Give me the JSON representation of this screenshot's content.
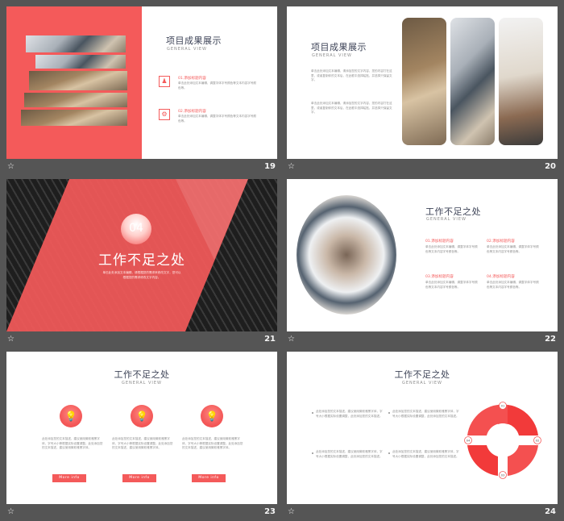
{
  "slides": [
    {
      "number": "19",
      "title": "项目成果展示",
      "subtitle": "GENERAL VIEW",
      "items": [
        {
          "heading": "01.添加标题内容",
          "text": "单击此处添加文本编辑，调整字体字号颜色等文本内容字号颜色等。"
        },
        {
          "heading": "02.添加标题内容",
          "text": "单击此处添加文本编辑，调整字体字号颜色等文本内容字号颜色等。"
        }
      ]
    },
    {
      "number": "20",
      "title": "项目成果展示",
      "subtitle": "GENERAL VIEW",
      "paragraphs": [
        "单击此处添加文本编辑，请添加您的文字内容，您的内容打在这里，或者复制你的文本后，在此框中选择粘贴，并选择只保留文字。",
        "单击此处添加文本编辑，请添加您的文字内容，您的内容打在这里，或者复制你的文本后，在此框中选择粘贴，并选择只保留文字。"
      ]
    },
    {
      "number": "21",
      "badge": "04",
      "title": "工作不足之处",
      "text": "单击此处添加文本编辑，请根据您的需求来修改文字，您可以根据您的需求修改文字内容。"
    },
    {
      "number": "22",
      "title": "工作不足之处",
      "subtitle": "GENERAL VIEW",
      "items": [
        {
          "heading": "01.添加标题内容",
          "text": "单击此处添加文本编辑，调整字体字号颜色等文本内容字号颜色等。"
        },
        {
          "heading": "02.添加标题内容",
          "text": "单击此处添加文本编辑，调整字体字号颜色等文本内容字号颜色等。"
        },
        {
          "heading": "03.添加标题内容",
          "text": "单击此处添加文本编辑，调整字体字号颜色等文本内容字号颜色等。"
        },
        {
          "heading": "04.添加标题内容",
          "text": "单击此处添加文本编辑，调整字体字号颜色等文本内容字号颜色等。"
        }
      ]
    },
    {
      "number": "23",
      "title": "工作不足之处",
      "subtitle": "GENERAL VIEW",
      "columns": [
        {
          "text": "此处添加您的文本描述，建议使用微软雅黑字体，字号大小等根据实际设置调整。此处添加您的文本描述，建议使用微软雅黑字体。",
          "button": "More info"
        },
        {
          "text": "此处添加您的文本描述，建议使用微软雅黑字体，字号大小等根据实际设置调整。此处添加您的文本描述，建议使用微软雅黑字体。",
          "button": "More info"
        },
        {
          "text": "此处添加您的文本描述，建议使用微软雅黑字体，字号大小等根据实际设置调整。此处添加您的文本描述，建议使用微软雅黑字体。",
          "button": "More info"
        }
      ]
    },
    {
      "number": "24",
      "title": "工作不足之处",
      "subtitle": "GENERAL VIEW",
      "notes": [
        "此处添加您的文本描述，建议使用微软雅黑字体，字号大小根据实际设置调整，此处添加您的文本描述。",
        "此处添加您的文本描述，建议使用微软雅黑字体，字号大小根据实际设置调整，此处添加您的文本描述。",
        "此处添加您的文本描述，建议使用微软雅黑字体，字号大小根据实际设置调整，此处添加您的文本描述。",
        "此处添加您的文本描述，建议使用微软雅黑字体，字号大小根据实际设置调整，此处添加您的文本描述。"
      ],
      "ring_labels": [
        "01",
        "02",
        "03",
        "04"
      ]
    }
  ],
  "colors": {
    "accent": "#f45a5a",
    "background": "#555555",
    "title": "#3d4357"
  },
  "icons": {
    "footer": "star-icon",
    "slide19_item1": "person-icon",
    "slide19_item2": "gear-icon",
    "slide23": "bulb-icon"
  }
}
